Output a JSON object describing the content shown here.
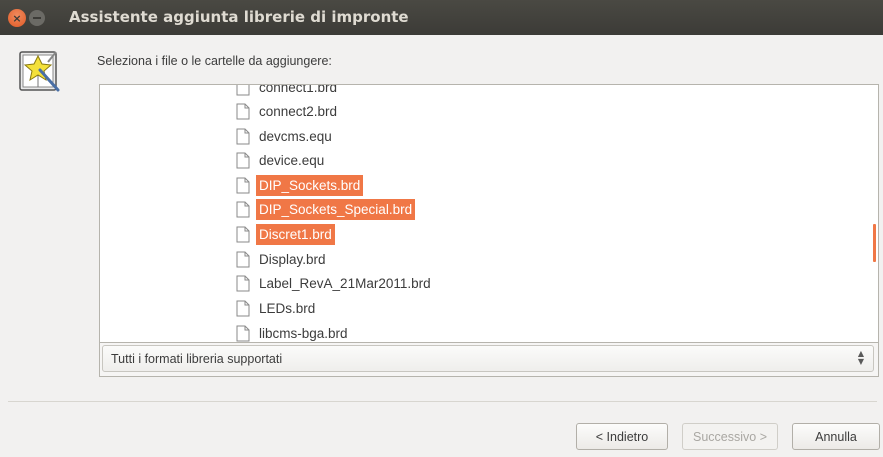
{
  "window": {
    "title": "Assistente aggiunta librerie di impronte"
  },
  "wizard": {
    "icon": "wizard-book-icon",
    "prompt": "Seleziona i file o le cartelle da aggiungere:"
  },
  "files": [
    {
      "name": "connect1.brd",
      "selected": false
    },
    {
      "name": "connect2.brd",
      "selected": false
    },
    {
      "name": "devcms.equ",
      "selected": false
    },
    {
      "name": "device.equ",
      "selected": false
    },
    {
      "name": "DIP_Sockets.brd",
      "selected": true
    },
    {
      "name": "DIP_Sockets_Special.brd",
      "selected": true
    },
    {
      "name": "Discret1.brd",
      "selected": true
    },
    {
      "name": "Display.brd",
      "selected": false
    },
    {
      "name": "Label_RevA_21Mar2011.brd",
      "selected": false
    },
    {
      "name": "LEDs.brd",
      "selected": false
    },
    {
      "name": "libcms-bga.brd",
      "selected": false
    }
  ],
  "filter": {
    "selected": "Tutti i formati libreria supportati"
  },
  "buttons": {
    "back": "< Indietro",
    "next": "Successivo >",
    "cancel": "Annulla"
  },
  "colors": {
    "selection": "#f07746",
    "titlebar": "#3c3b37",
    "close_button": "#e05a26"
  }
}
